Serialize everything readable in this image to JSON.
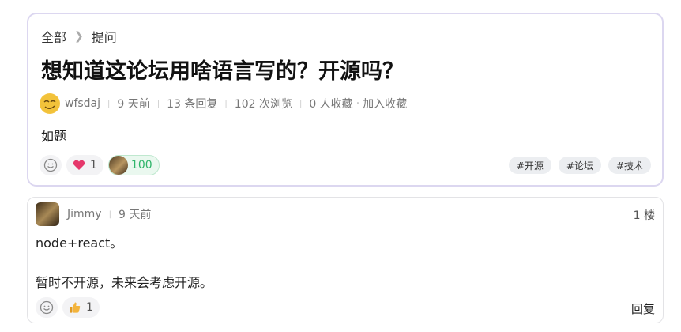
{
  "breadcrumb": {
    "root": "全部",
    "current": "提问"
  },
  "post": {
    "title": "想知道这论坛用啥语言写的？开源吗？",
    "author": "wfsdaj",
    "time": "9 天前",
    "replies": "13 条回复",
    "views": "102 次浏览",
    "favorites": "0 人收藏",
    "add_favorite": "加入收藏",
    "body": "如题",
    "reactions": {
      "heart_count": "1",
      "score": "100"
    },
    "tags": [
      "#开源",
      "#论坛",
      "#技术"
    ]
  },
  "reply": {
    "author": "Jimmy",
    "time": "9 天前",
    "floor": "1 楼",
    "lines": [
      "node+react。",
      "暂时不开源，未来会考虑开源。"
    ],
    "thumbs_count": "1",
    "reply_label": "回复"
  },
  "colors": {
    "accent_border": "#dcd7f0",
    "green": "#2fb56a",
    "heart": "#e5376b"
  }
}
